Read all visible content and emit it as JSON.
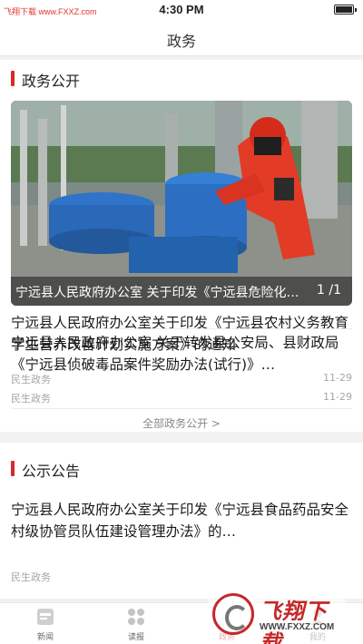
{
  "status_bar": {
    "watermark": "飞翔下载 www.FXXZ.com",
    "time": "4:30 PM"
  },
  "nav": {
    "title": "政务"
  },
  "gov_open": {
    "title": "政务公开",
    "banner": {
      "caption": "宁远县人民政府办公室 关于印发《宁远县危险化学品…",
      "counter": "1 /1"
    },
    "items": [
      {
        "title": "宁远县人民政府办公室关于印发《宁远县农村义务教育学生营养改善计划实施方案》的通知",
        "category": "民生政务",
        "date": "11-29"
      },
      {
        "title": "宁远县人民政府办公室 关于转发县公安局、县财政局《宁远县侦破毒品案件奖励办法(试行)》…",
        "category": "民生政务",
        "date": "11-29"
      }
    ],
    "more_label": "全部政务公开 >"
  },
  "notice": {
    "title": "公示公告",
    "items": [
      {
        "title": "宁远县人民政府办公室关于印发《宁远县食品药品安全村级协管员队伍建设管理办法》的…",
        "category": "民生政务"
      }
    ]
  },
  "tabbar": {
    "tabs": [
      {
        "label": "新闻",
        "icon": "news-icon"
      },
      {
        "label": "读报",
        "icon": "grid-icon"
      },
      {
        "label": "政务",
        "icon": "gov-icon",
        "active": true
      },
      {
        "label": "我的",
        "icon": "user-icon"
      }
    ]
  },
  "watermark": {
    "text": "飞翔下载",
    "url": "WWW.FXXZ.COM"
  },
  "colors": {
    "accent": "#d62b2b",
    "background": "#f2f2f2"
  }
}
